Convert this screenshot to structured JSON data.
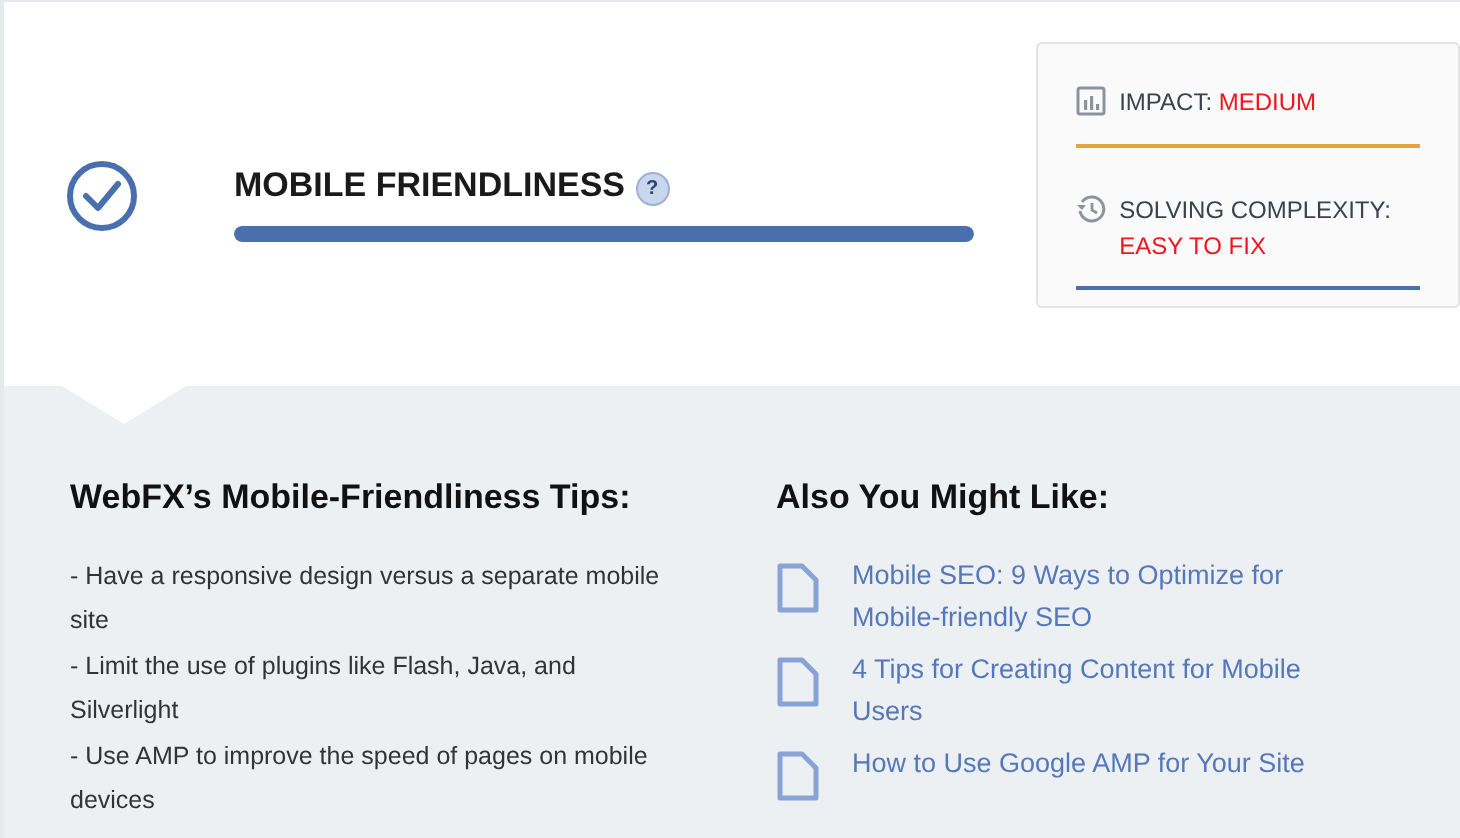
{
  "check": {
    "title": "MOBILE FRIENDLINESS",
    "help": "?",
    "level": 1
  },
  "meta": [
    {
      "kind": "impact",
      "label": "IMPACT:",
      "value": "MEDIUM",
      "color": "#e8a33d"
    },
    {
      "kind": "complexity",
      "label": "SOLVING COMPLEXITY:",
      "value": "EASY TO FIX",
      "color": "#4a6fae"
    }
  ],
  "tips": {
    "heading": "WebFX’s Mobile-Friendliness Tips:",
    "items": [
      "- Have a responsive design versus a separate mobile site",
      "- Limit the use of plugins like Flash, Java, and Silverlight",
      "- Use AMP to improve the speed of pages on mobile devices"
    ]
  },
  "related": {
    "heading": "Also You Might Like:",
    "links": [
      "Mobile SEO: 9 Ways to Optimize for Mobile-friendly SEO",
      "4 Tips for Creating Content for Mobile Users",
      "How to Use Google AMP for Your Site"
    ]
  }
}
